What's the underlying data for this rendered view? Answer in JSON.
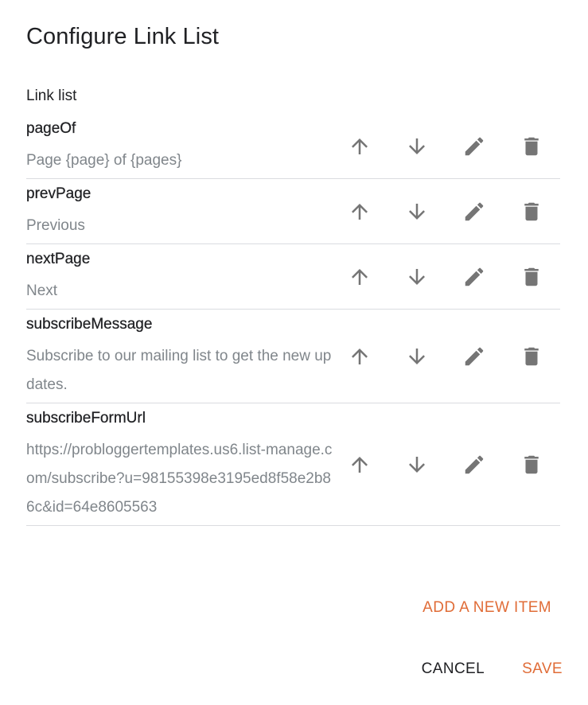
{
  "dialog": {
    "title": "Configure Link List",
    "section_label": "Link list",
    "add_item_label": "ADD A NEW ITEM",
    "cancel_label": "CANCEL",
    "save_label": "SAVE",
    "accent_color": "#e06c37"
  },
  "items": [
    {
      "key": "pageOf",
      "value": "Page {page} of {pages}"
    },
    {
      "key": "prevPage",
      "value": "Previous"
    },
    {
      "key": "nextPage",
      "value": "Next"
    },
    {
      "key": "subscribeMessage",
      "value": "Subscribe to our mailing list to get the new updates."
    },
    {
      "key": "subscribeFormUrl",
      "value": "https://problogger​templates.us6.list-manage.com/subscribe?u=98155398e3195ed8f58e2b86c&id=64e8605563"
    }
  ],
  "icons": {
    "move_up": "arrow-up-icon",
    "move_down": "arrow-down-icon",
    "edit": "pencil-icon",
    "delete": "trash-icon"
  }
}
